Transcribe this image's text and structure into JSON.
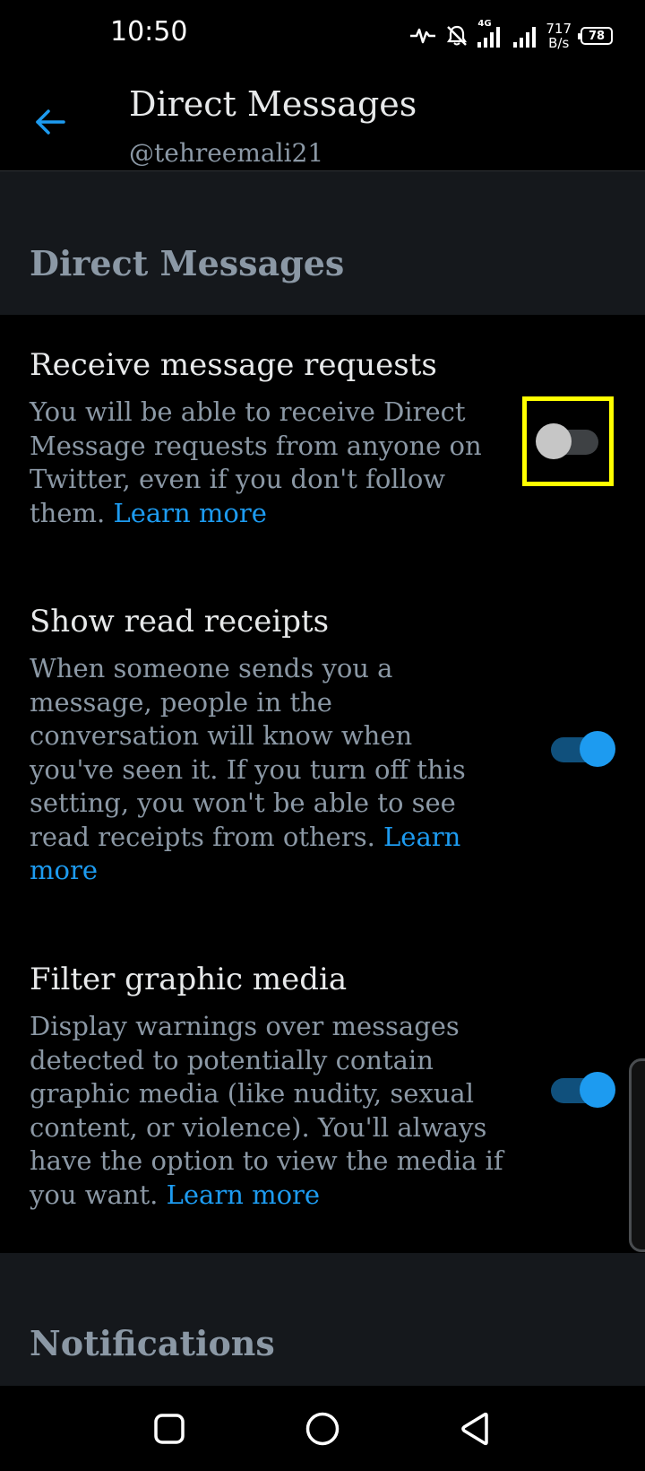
{
  "status_bar": {
    "time": "10:50",
    "net_speed_value": "717",
    "net_speed_unit": "B/s",
    "battery": "78",
    "network": "4G",
    "icons": [
      "activity-icon",
      "bell-off-icon",
      "signal-4g-icon",
      "signal-icon",
      "battery-icon"
    ]
  },
  "header": {
    "title": "Direct Messages",
    "subtitle": "@tehreemali21",
    "back_icon": "arrow-left-icon"
  },
  "sections": {
    "dm_header": "Direct Messages",
    "notifications_header": "Notifications"
  },
  "settings": [
    {
      "title": "Receive message requests",
      "description": "You will be able to receive Direct Message requests from anyone on Twitter, even if you don't follow them. ",
      "learn_more": "Learn more",
      "enabled": false
    },
    {
      "title": "Show read receipts",
      "description": "When someone sends you a message, people in the conversation will know when you've seen it. If you turn off this setting, you won't be able to see read receipts from others. ",
      "learn_more": "Learn more",
      "enabled": true
    },
    {
      "title": "Filter graphic media",
      "description": "Display warnings over messages detected to potentially contain graphic media (like nudity, sexual content, or violence). You'll always have the option to view the media if you want. ",
      "learn_more": "Learn more",
      "enabled": true
    }
  ],
  "colors": {
    "accent": "#1d9bf0",
    "highlight": "#ffff00",
    "background": "#000000",
    "section_bg": "#15181c"
  },
  "nav": {
    "icons": [
      "square-recents-icon",
      "circle-home-icon",
      "triangle-back-icon"
    ]
  }
}
